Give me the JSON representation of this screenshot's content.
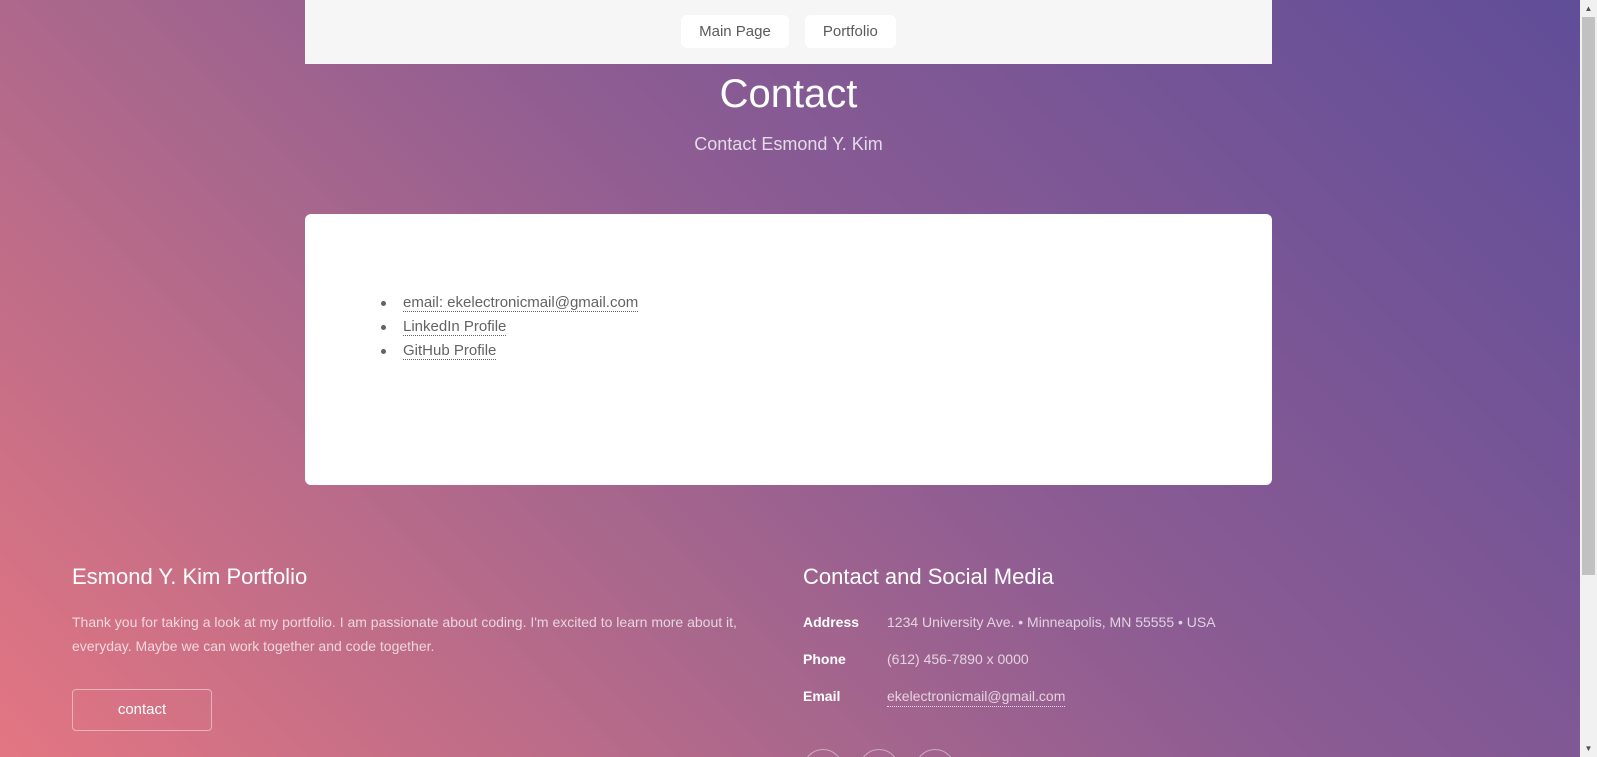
{
  "nav": {
    "items": [
      {
        "label": "Main Page"
      },
      {
        "label": "Portfolio"
      }
    ]
  },
  "header": {
    "title": "Contact",
    "subtitle": "Contact Esmond Y. Kim"
  },
  "contact_list": {
    "items": [
      {
        "label": "email: ekelectronicmail@gmail.com"
      },
      {
        "label": "LinkedIn Profile"
      },
      {
        "label": "GitHub Profile"
      }
    ]
  },
  "footer": {
    "left": {
      "heading": "Esmond Y. Kim Portfolio",
      "text": "Thank you for taking a look at my portfolio. I am passionate about coding. I'm excited to learn more about it, everyday. Maybe we can work together and code together.",
      "button_label": "contact"
    },
    "right": {
      "heading": "Contact and Social Media",
      "address_label": "Address",
      "address_value": "1234 University Ave. • Minneapolis, MN 55555 • USA",
      "phone_label": "Phone",
      "phone_value": "(612) 456-7890 x 0000",
      "email_label": "Email",
      "email_value": "ekelectronicmail@gmail.com"
    },
    "social_icons": [
      "twitter-icon",
      "github-icon",
      "linkedin-icon"
    ]
  },
  "colors": {
    "gradient_start": "#e37682",
    "gradient_end": "#5f4d99",
    "nav_background": "#f6f6f6",
    "card_background": "#ffffff"
  }
}
